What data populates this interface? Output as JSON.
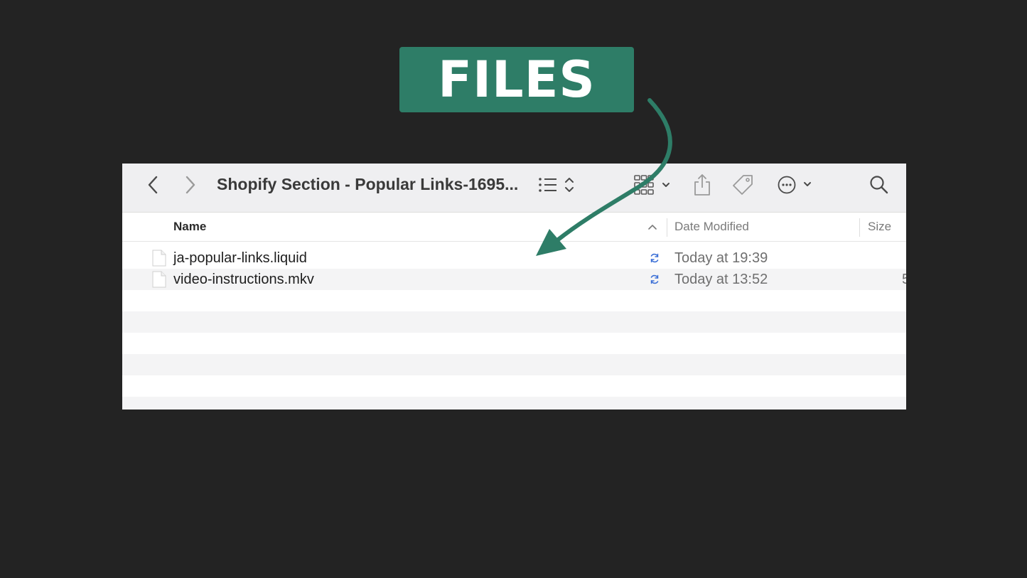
{
  "callout": {
    "label": "FILES",
    "color": "#2e7d67"
  },
  "window": {
    "title": "Shopify Section - Popular Links-1695...",
    "toolbar": {
      "icons": [
        "chevron-left-icon",
        "chevron-right-icon",
        "list-view-icon",
        "grid-view-icon",
        "share-icon",
        "tag-icon",
        "more-icon",
        "search-icon"
      ]
    }
  },
  "columns": {
    "name": "Name",
    "date_modified": "Date Modified",
    "size": "Size"
  },
  "files": [
    {
      "name": "ja-popular-links.liquid",
      "date": "Today at 19:39",
      "size": ""
    },
    {
      "name": "video-instructions.mkv",
      "date": "Today at 13:52",
      "size": "5"
    }
  ]
}
